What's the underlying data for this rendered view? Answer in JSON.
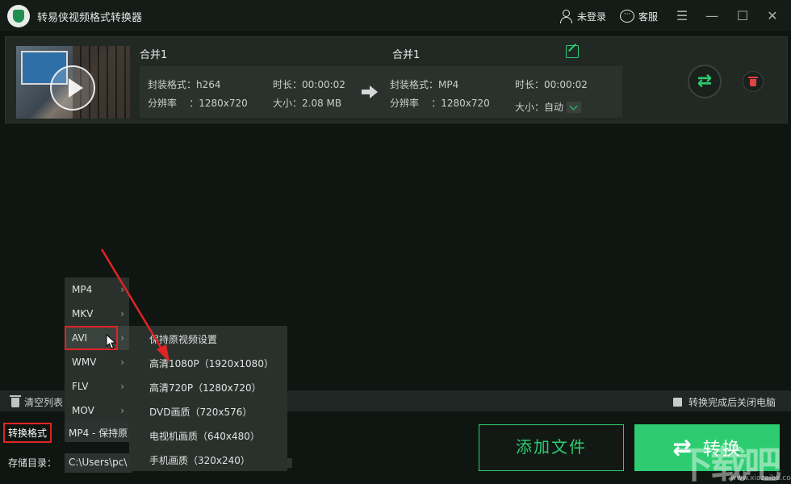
{
  "app": {
    "title": "转易侠视频格式转换器",
    "login": "未登录",
    "service": "客服"
  },
  "window": {
    "menu": "☰",
    "minimize": "—",
    "maximize": "☐",
    "close": "✕"
  },
  "file": {
    "source_name": "合并1",
    "target_name": "合并1",
    "source": {
      "format": "封装格式：h264",
      "duration": "时长：00:00:02",
      "resolution": "分辨率    ：1280x720",
      "size": "大小：2.08 MB"
    },
    "target": {
      "format": "封装格式：MP4",
      "duration": "时长：00:00:02",
      "resolution": "分辨率    ：1280x720",
      "size": "大小：自动"
    }
  },
  "bottom": {
    "clear_list": "清空列表",
    "shutdown": "转换完成后关闭电脑"
  },
  "format": {
    "label": "转换格式",
    "value": "MP4 - 保持原"
  },
  "save": {
    "label": "存储目录：",
    "path": "C:\\Users\\pc\\"
  },
  "buttons": {
    "add": "添加文件",
    "convert": "转换",
    "swap_glyph": "⇄"
  },
  "menu_formats": [
    {
      "label": "MP4"
    },
    {
      "label": "MKV"
    },
    {
      "label": "AVI"
    },
    {
      "label": "WMV"
    },
    {
      "label": "FLV"
    },
    {
      "label": "MOV"
    }
  ],
  "menu_chevron": "›",
  "menu_presets": [
    {
      "label": "保持原视频设置"
    },
    {
      "label": "高清1080P（1920x1080）"
    },
    {
      "label": "高清720P（1280x720）"
    },
    {
      "label": "DVD画质（720x576）"
    },
    {
      "label": "电视机画质（640x480）"
    },
    {
      "label": "手机画质（320x240）"
    }
  ],
  "watermark": {
    "text": "下载吧",
    "url": "www.xiazaiba.com"
  },
  "colors": {
    "accent": "#2ecc71",
    "annotation": "#e02424"
  }
}
